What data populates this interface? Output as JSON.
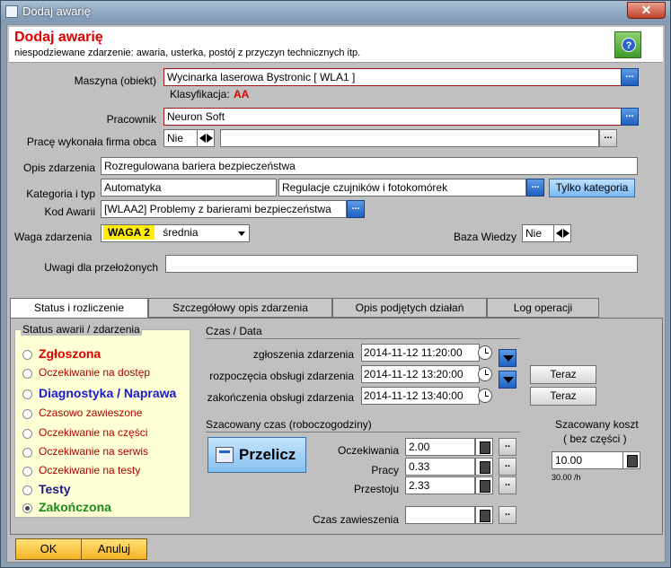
{
  "window": {
    "title": "Dodaj awarię",
    "close_glyph": "✕"
  },
  "header": {
    "title": "Dodaj awarię",
    "subtitle": "niespodziewane zdarzenie: awaria, usterka, postój z przyczyn technicznych itp.",
    "help_glyph": "?"
  },
  "form": {
    "machine_label": "Maszyna (obiekt)",
    "machine_value": "Wycinarka laserowa Bystronic [ WLA1 ]",
    "classification_label": "Klasyfikacja:",
    "classification_value": "AA",
    "worker_label": "Pracownik",
    "worker_value": "Neuron Soft",
    "external_label": "Pracę wykonała firma obca",
    "external_value": "Nie",
    "external_firm_value": "",
    "description_label": "Opis zdarzenia",
    "description_value": "Rozregulowana bariera bezpieczeństwa",
    "category_label": "Kategoria i typ",
    "category_value": "Automatyka",
    "type_value": "Regulacje czujników i fotokomórek",
    "only_category_label": "Tylko kategoria",
    "fault_code_label": "Kod Awarii",
    "fault_code_value": "[WLAA2] Problemy z barierami bezpieczeństwa",
    "weight_label": "Waga zdarzenia",
    "weight_badge": "WAGA 2",
    "weight_value": "średnia",
    "knowledge_label": "Baza Wiedzy",
    "knowledge_value": "Nie",
    "notes_label": "Uwagi dla przełożonych",
    "notes_value": "",
    "dots": "...",
    "dots_small": ".."
  },
  "tabs": [
    {
      "label": "Status i rozliczenie"
    },
    {
      "label": "Szczegółowy opis zdarzenia"
    },
    {
      "label": "Opis podjętych działań"
    },
    {
      "label": "Log operacji"
    }
  ],
  "status": {
    "title": "Status  awarii / zdarzenia",
    "items": [
      {
        "label": "Zgłoszona",
        "color": "#e00000",
        "bold": true
      },
      {
        "label": "Oczekiwanie na dostęp",
        "color": "#b00000",
        "bold": false
      },
      {
        "label": "Diagnostyka / Naprawa",
        "color": "#1a1ad0",
        "bold": true
      },
      {
        "label": "Czasowo zawieszone",
        "color": "#b00000",
        "bold": false
      },
      {
        "label": "Oczekiwanie na części",
        "color": "#b00000",
        "bold": false
      },
      {
        "label": "Oczekiwanie na serwis",
        "color": "#b00000",
        "bold": false
      },
      {
        "label": "Oczekiwanie na testy",
        "color": "#b00000",
        "bold": false
      },
      {
        "label": "Testy",
        "color": "#1a1a80",
        "bold": true
      },
      {
        "label": "Zakończona",
        "color": "#1a8a1a",
        "bold": true
      }
    ],
    "selected": "Zakończona"
  },
  "times": {
    "title": "Czas / Data",
    "reported_label": "zgłoszenia zdarzenia",
    "reported_value": "2014-11-12 11:20:00",
    "started_label": "rozpoczęcia obsługi zdarzenia",
    "started_value": "2014-11-12 13:20:00",
    "finished_label": "zakończenia obsługi zdarzenia",
    "finished_value": "2014-11-12 13:40:00",
    "now_label": "Teraz"
  },
  "estimate": {
    "title": "Szacowany czas    (roboczogodziny)",
    "recalc_label": "Przelicz",
    "waiting_label": "Oczekiwania",
    "waiting_value": "2.00",
    "work_label": "Pracy",
    "work_value": "0.33",
    "downtime_label": "Przestoju",
    "downtime_value": "2.33",
    "suspend_label": "Czas  zawieszenia",
    "suspend_value": "",
    "cost_title": "Szacowany koszt",
    "cost_subtitle": "( bez części )",
    "cost_value": "10.00",
    "rate_value": "30.00 /h"
  },
  "buttons": {
    "ok": "OK",
    "cancel": "Anuluj"
  }
}
